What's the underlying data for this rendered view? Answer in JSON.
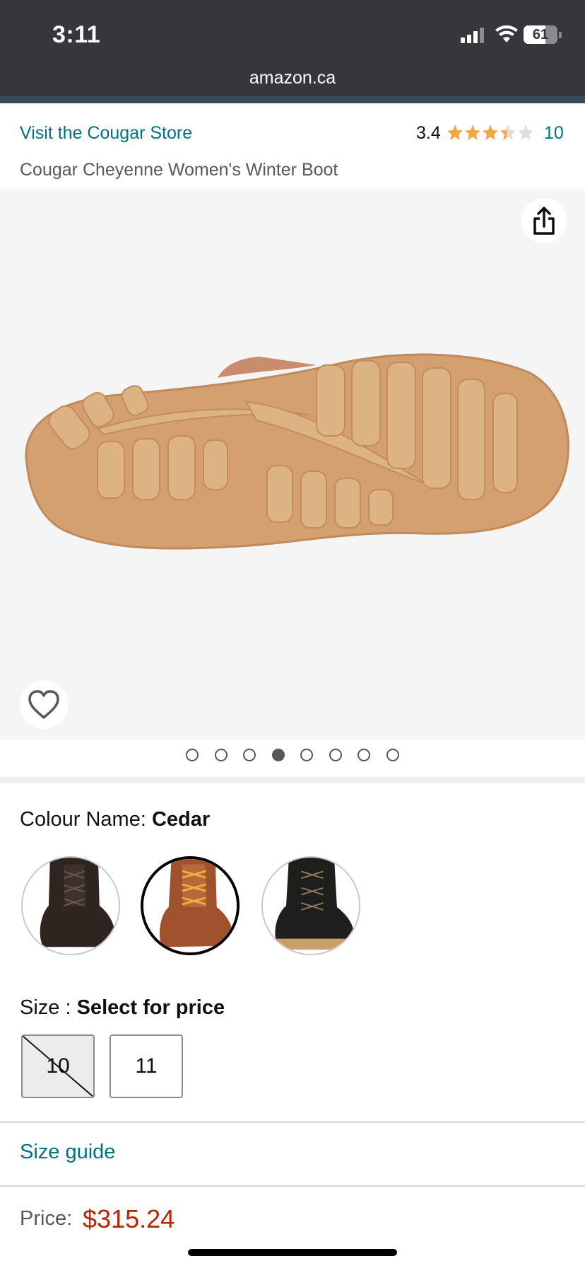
{
  "status_bar": {
    "time": "3:11",
    "battery": "61"
  },
  "browser": {
    "url": "amazon.ca"
  },
  "product": {
    "store_link": "Visit the Cougar Store",
    "rating": "3.4",
    "rating_count": "10",
    "title": "Cougar Cheyenne Women's Winter Boot"
  },
  "gallery": {
    "total_images": 8,
    "active_index": 4
  },
  "colour": {
    "label": "Colour Name: ",
    "value": "Cedar",
    "swatches": [
      "Black",
      "Cedar",
      "Black/Gum"
    ],
    "selected": "Cedar"
  },
  "size": {
    "label": "Size : ",
    "value": "Select for price",
    "options": [
      {
        "label": "10",
        "available": false
      },
      {
        "label": "11",
        "available": true
      }
    ]
  },
  "size_guide": "Size guide",
  "price": {
    "label": "Price:",
    "value": "$315.24"
  },
  "colors": {
    "link": "#017185",
    "price": "#b12704",
    "star": "#f3a847"
  }
}
